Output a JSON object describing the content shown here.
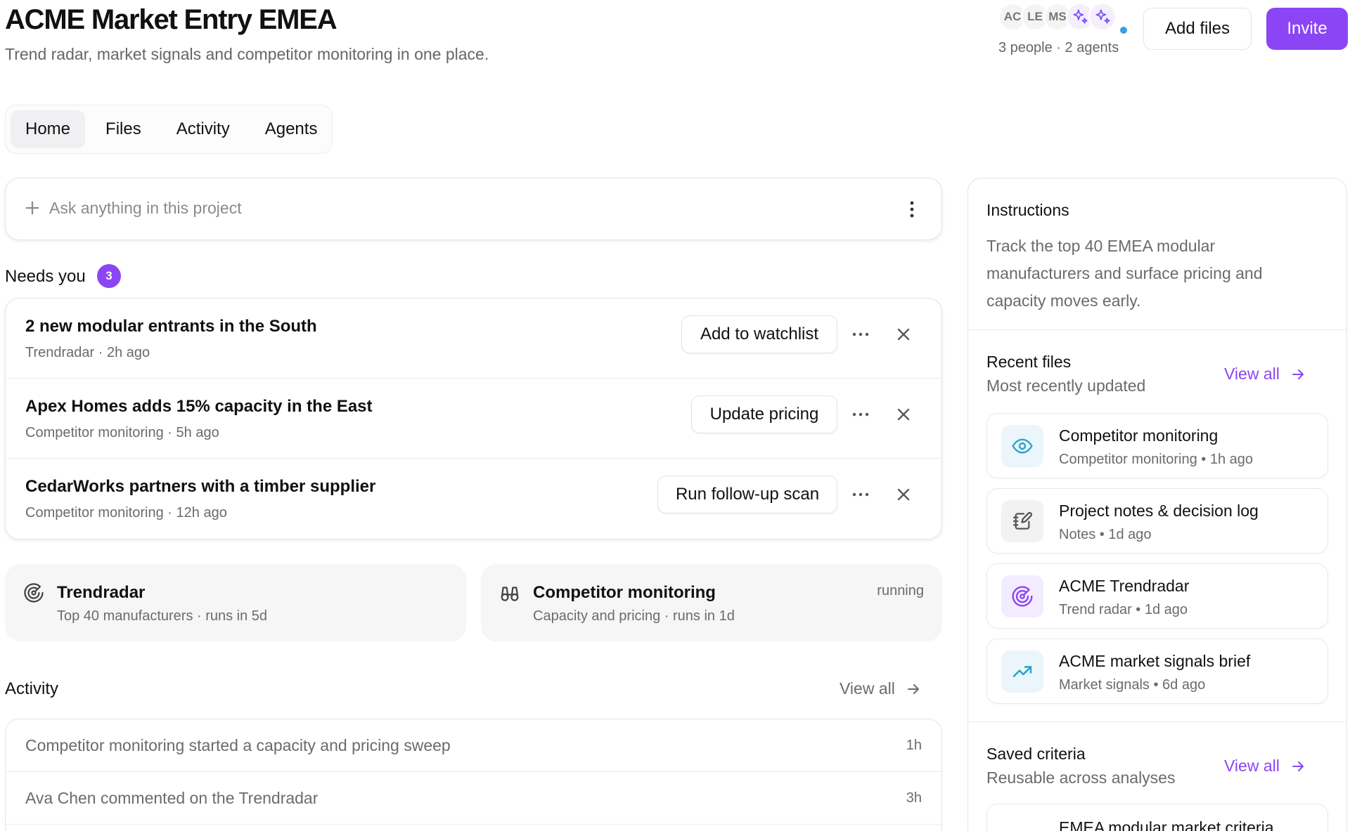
{
  "header": {
    "title": "ACME Market Entry EMEA",
    "subtitle": "Trend radar, market signals and competitor monitoring in one place.",
    "avatars": [
      "AC",
      "LE",
      "MS"
    ],
    "people_count": "3 people · 2 agents",
    "add_files_label": "Add files",
    "invite_label": "Invite"
  },
  "tabs": [
    {
      "label": "Home",
      "active": true
    },
    {
      "label": "Files"
    },
    {
      "label": "Activity"
    },
    {
      "label": "Agents"
    }
  ],
  "ask": {
    "placeholder": "Ask anything in this project"
  },
  "needs_you": {
    "title": "Needs you",
    "count": "3",
    "items": [
      {
        "title": "2 new modular entrants in the South",
        "meta": "Trendradar · 2h ago",
        "action": "Add to watchlist"
      },
      {
        "title": "Apex Homes adds 15% capacity in the East",
        "meta": "Competitor monitoring · 5h ago",
        "action": "Update pricing"
      },
      {
        "title": "CedarWorks partners with a timber supplier",
        "meta": "Competitor monitoring · 12h ago",
        "action": "Run follow-up scan"
      }
    ]
  },
  "agents": [
    {
      "title": "Trendradar",
      "meta": "Top 40 manufacturers · runs in 5d",
      "icon": "radar-icon",
      "status": ""
    },
    {
      "title": "Competitor monitoring",
      "meta": "Capacity and pricing · runs in 1d",
      "icon": "binoculars-icon",
      "status": "running"
    }
  ],
  "activity": {
    "title": "Activity",
    "view_all": "View all",
    "items": [
      {
        "text": "Competitor monitoring started a capacity and pricing sweep",
        "time": "1h"
      },
      {
        "text": "Ava Chen commented on the Trendradar",
        "time": "3h"
      }
    ]
  },
  "instructions": {
    "title": "Instructions",
    "body": "Track the top 40 EMEA modular manufacturers and surface pricing and capacity moves early."
  },
  "recent_files": {
    "title": "Recent files",
    "subtitle": "Most recently updated",
    "view_all": "View all",
    "items": [
      {
        "title": "Competitor monitoring",
        "meta": "Competitor monitoring • 1h ago",
        "icon": "eye-icon",
        "color": "#2ba3c9"
      },
      {
        "title": "Project notes & decision log",
        "meta": "Notes • 1d ago",
        "icon": "notebook-pen-icon",
        "color": "#555555"
      },
      {
        "title": "ACME Trendradar",
        "meta": "Trend radar • 1d ago",
        "icon": "radar-icon",
        "color": "#8b45f5"
      },
      {
        "title": "ACME market signals brief",
        "meta": "Market signals • 6d ago",
        "icon": "trending-up-icon",
        "color": "#2ba3c9"
      }
    ]
  },
  "saved_criteria": {
    "title": "Saved criteria",
    "subtitle": "Reusable across analyses",
    "view_all": "View all",
    "items": [
      {
        "title": "EMEA modular market criteria"
      }
    ]
  },
  "colors": {
    "accent": "#8b45f5",
    "teal": "#2ba3c9",
    "presence": "#3b9ee8"
  }
}
